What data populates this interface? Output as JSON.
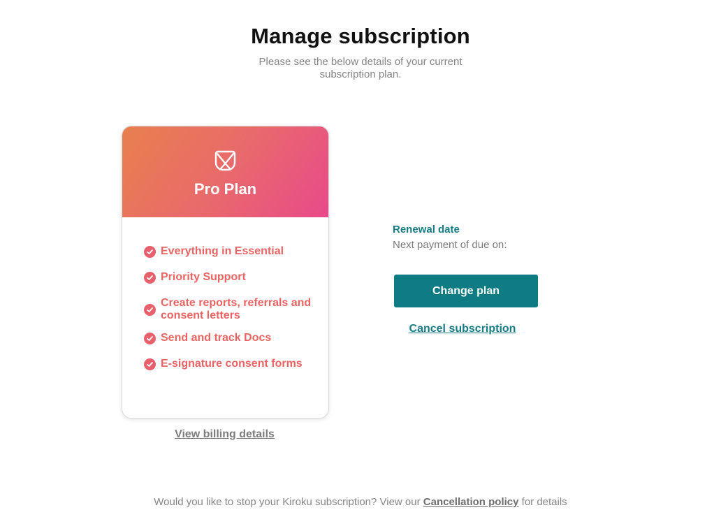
{
  "header": {
    "title": "Manage subscription",
    "subtitle": "Please see the below details of your current subscription plan."
  },
  "plan_card": {
    "icon": "kiroku-logo-icon",
    "name": "Pro Plan",
    "features": [
      "Everything in Essential",
      "Priority Support",
      "Create reports, referrals and consent letters",
      "Send and track Docs",
      "E-signature consent forms"
    ],
    "billing_link": "View billing details"
  },
  "renewal": {
    "label": "Renewal date",
    "text": "Next payment of due on:",
    "change_plan_label": "Change plan",
    "cancel_label": "Cancel subscription"
  },
  "footer": {
    "text_before": "Would you like to stop your Kiroku subscription? View our ",
    "link": "Cancellation policy",
    "text_after": " for details"
  },
  "colors": {
    "accent_teal": "#0f7c84",
    "feature_pink": "#ea6464",
    "gradient_start": "#e8804d",
    "gradient_end": "#e84a8a"
  }
}
